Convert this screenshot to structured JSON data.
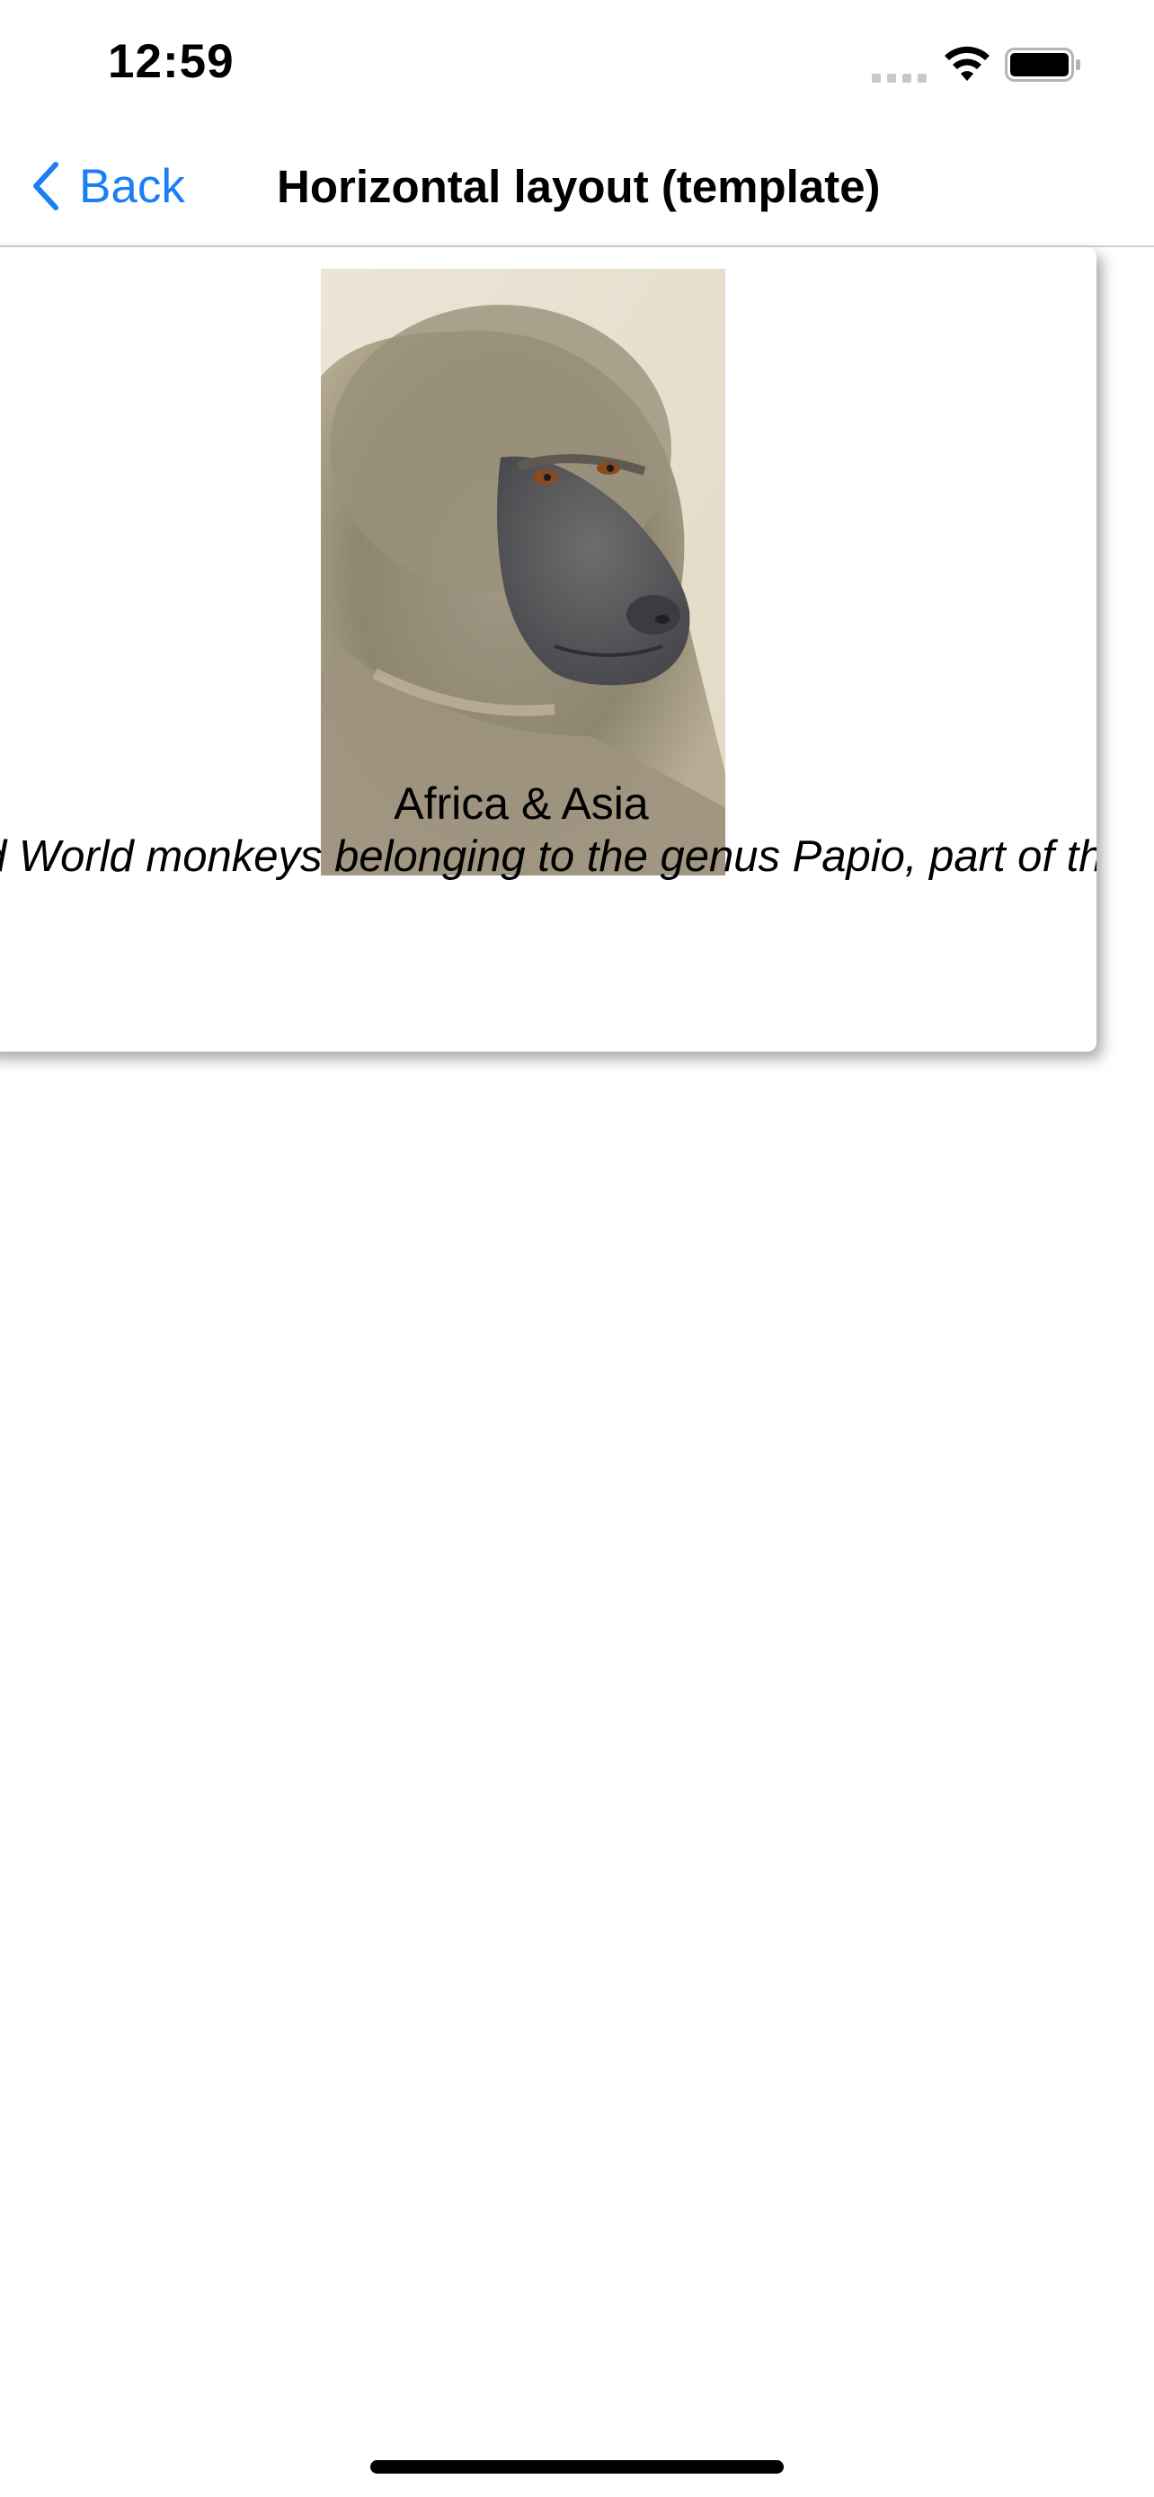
{
  "status_bar": {
    "time": "12:59",
    "icons": [
      "cell-signal-icon",
      "wifi-icon",
      "battery-icon"
    ]
  },
  "nav": {
    "back_label": "Back",
    "title": "Horizontal layout (template)",
    "accent_color": "#1a7ef5"
  },
  "card": {
    "image": "baboon-photo",
    "region": "Africa & Asia",
    "description": "Baboons are Old World monkeys belonging to the genus Papio, part of the subfamily Cercopithecinae."
  }
}
